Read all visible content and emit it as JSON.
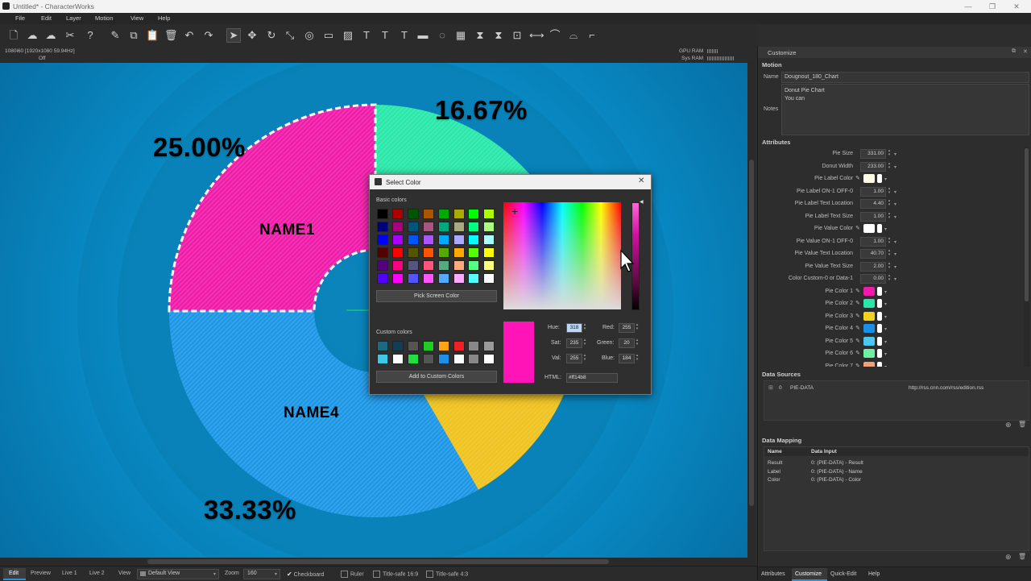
{
  "window": {
    "title": "Untitled* - CharacterWorks"
  },
  "menu": [
    "File",
    "Edit",
    "Layer",
    "Motion",
    "View",
    "Help"
  ],
  "info": {
    "resolution": "1080i60 [1920x1080 59.94Hz]",
    "state": "Off",
    "gpu_ram": "GPU RAM",
    "sys_ram": "Sys RAM"
  },
  "chart_data": {
    "type": "pie",
    "categories": [
      "NAME1",
      "",
      "",
      "NAME4"
    ],
    "values": [
      25.0,
      16.67,
      25.0,
      33.33
    ],
    "value_labels": [
      "25.00%",
      "16.67%",
      "",
      "33.33%"
    ],
    "colors": [
      "#f01aa8",
      "#27e8a8",
      "#efc21c",
      "#1a96e6"
    ],
    "donut": true,
    "half": false
  },
  "bottombar": {
    "tabs": [
      "Edit",
      "Preview",
      "Live 1",
      "Live 2"
    ],
    "view_label": "View",
    "view_value": "Default View",
    "zoom_label": "Zoom",
    "zoom_value": "160",
    "checkboard": "Checkboard",
    "ruler": "Ruler",
    "title_safe_169": "Title-safe 16:9",
    "title_safe_43": "Title-safe 4:3"
  },
  "panel": {
    "title": "Customize",
    "motion_header": "Motion",
    "name_label": "Name",
    "name_value": "Dougnout_180_Chart",
    "notes_label": "Notes",
    "notes_line1": "Donut Pie Chart",
    "notes_line2": "You can",
    "attributes_header": "Attributes",
    "attributes": [
      {
        "label": "Pie Size",
        "value": "331.00"
      },
      {
        "label": "Donut Width",
        "value": "233.00"
      },
      {
        "label": "Pie Label Color",
        "swatch": "#fffbe6"
      },
      {
        "label": "Pie Label ON-1 OFF-0",
        "value": "1.00"
      },
      {
        "label": "Pie Label Text Location",
        "value": "4.40"
      },
      {
        "label": "Pie Label Text Size",
        "value": "1.00"
      },
      {
        "label": "Pie Value Color",
        "swatch": "#ffffff"
      },
      {
        "label": "Pie Value ON-1 OFF-0",
        "value": "1.00"
      },
      {
        "label": "Pie Value Text Location",
        "value": "40.70"
      },
      {
        "label": "Pie Value Text Size",
        "value": "2.00"
      },
      {
        "label": "Color Custom-0 or Data-1",
        "value": "0.00"
      },
      {
        "label": "Pie Color 1",
        "swatch": "#f01aa8"
      },
      {
        "label": "Pie Color 2",
        "swatch": "#27e8a8"
      },
      {
        "label": "Pie Color 3",
        "swatch": "#f2d21c"
      },
      {
        "label": "Pie Color 4",
        "swatch": "#1a8fe6"
      },
      {
        "label": "Pie Color 5",
        "swatch": "#4cc8f0"
      },
      {
        "label": "Pie Color 6",
        "swatch": "#6ef0a0"
      },
      {
        "label": "Pie Color 7",
        "swatch": "#f2a078"
      }
    ],
    "data_sources_header": "Data Sources",
    "data_source": {
      "index": "0",
      "name": "PIE-DATA",
      "url": "http://rss.cnn.com/rss/edition.rss"
    },
    "data_mapping_header": "Data Mapping",
    "mapping_cols": [
      "Name",
      "Data Input"
    ],
    "mapping_rows": [
      {
        "name": "Result",
        "input": "0: (PIE-DATA) - Result"
      },
      {
        "name": "Label",
        "input": "0: (PIE-DATA) - Name"
      },
      {
        "name": "Color",
        "input": "0: (PIE-DATA) - Color"
      }
    ],
    "tabs": [
      "Attributes",
      "Customize",
      "Quick-Edit",
      "Help"
    ]
  },
  "dialog": {
    "title": "Select Color",
    "basic_colors_label": "Basic colors",
    "pick_screen": "Pick Screen Color",
    "custom_colors_label": "Custom colors",
    "add_custom": "Add to Custom Colors",
    "hue_label": "Hue:",
    "hue": "318",
    "sat_label": "Sat:",
    "sat": "235",
    "val_label": "Val:",
    "val": "255",
    "red_label": "Red:",
    "red": "255",
    "green_label": "Green:",
    "green": "20",
    "blue_label": "Blue:",
    "blue": "184",
    "html_label": "HTML:",
    "html": "#ff14b8",
    "current_color": "#ff14b8",
    "basic_colors": [
      "#000000",
      "#aa0000",
      "#005500",
      "#aa5500",
      "#00aa00",
      "#aaaa00",
      "#00ff00",
      "#aaff00",
      "#00007f",
      "#aa007f",
      "#00557f",
      "#aa557f",
      "#00aa7f",
      "#aaaa7f",
      "#00ff7f",
      "#aaff7f",
      "#0000ff",
      "#aa00ff",
      "#0055ff",
      "#aa55ff",
      "#00aaff",
      "#aaaaff",
      "#00ffff",
      "#aaffff",
      "#550000",
      "#ff0000",
      "#555500",
      "#ff5500",
      "#55aa00",
      "#ffaa00",
      "#55ff00",
      "#ffff00",
      "#55007f",
      "#ff007f",
      "#55557f",
      "#ff557f",
      "#55aa7f",
      "#ffaa7f",
      "#55ff7f",
      "#ffff7f",
      "#5500ff",
      "#ff00ff",
      "#5555ff",
      "#ff55ff",
      "#55aaff",
      "#ffaaff",
      "#55ffff",
      "#ffffff"
    ],
    "custom_colors": [
      "#1b6a80",
      "#123d55",
      "#555555",
      "#22cc22",
      "#ffa514",
      "#ee2222",
      "#888888",
      "#999999",
      "#3cc8e6",
      "#ffffff",
      "#22dd44",
      "#555555",
      "#1e8fe6",
      "#ffffff",
      "#888888",
      "#ffffff"
    ]
  }
}
